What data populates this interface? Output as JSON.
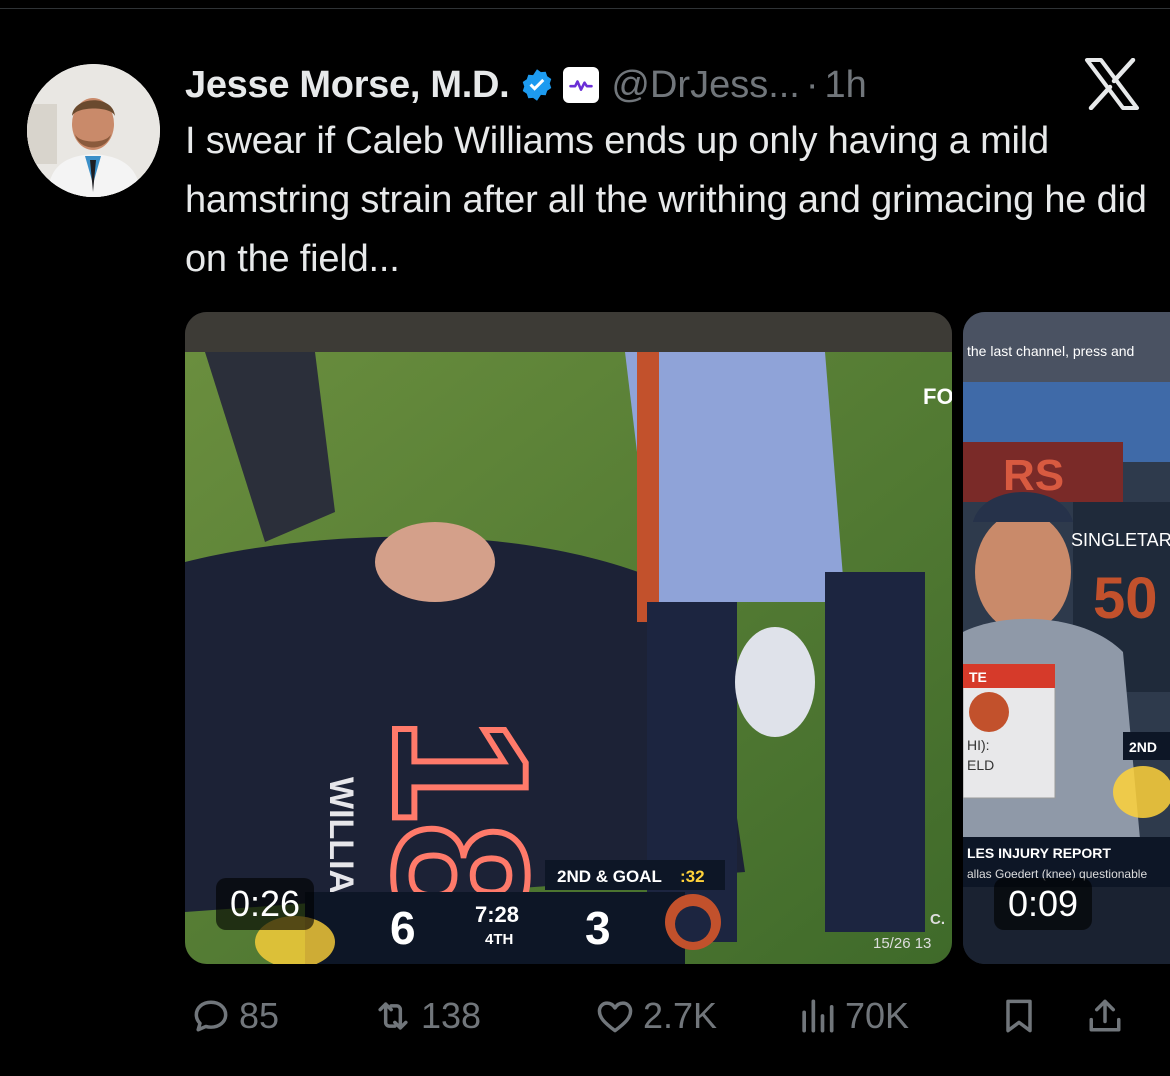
{
  "author": {
    "name": "Jesse Morse, M.D.",
    "handle": "@DrJess...",
    "separator": "·",
    "time": "1h"
  },
  "tweet": {
    "text": "I swear if Caleb Williams ends up only having a mild hamstring strain after all the writhing and grimacing he did on the field..."
  },
  "media": [
    {
      "duration": "0:26",
      "score_bug": {
        "down": "2ND & GOAL",
        "play_clock": ":32",
        "away_score": "6",
        "game_clock": "7:28",
        "quarter": "4TH",
        "home_score": "3",
        "jersey_number": "18",
        "jersey_name": "WILLIAMS",
        "network": "FO",
        "ticker": "15/26 13",
        "ticker_c": "C."
      }
    },
    {
      "duration": "0:09",
      "caption_top": "the last channel, press and",
      "sideline_name": "SINGLETARY",
      "sideline_number": "50",
      "banner_partial": "RS",
      "panel_label": "TE",
      "panel_line1": "HI):",
      "panel_line2": "ELD",
      "badge": "2ND",
      "injury_title": "LES INJURY REPORT",
      "injury_detail": "allas Goedert (knee) questionable"
    }
  ],
  "actions": {
    "replies": "85",
    "retweets": "138",
    "likes": "2.7K",
    "views": "70K"
  },
  "colors": {
    "background": "#000000",
    "text": "#e7e9ea",
    "muted": "#71767b",
    "verified": "#1d9bf0"
  }
}
